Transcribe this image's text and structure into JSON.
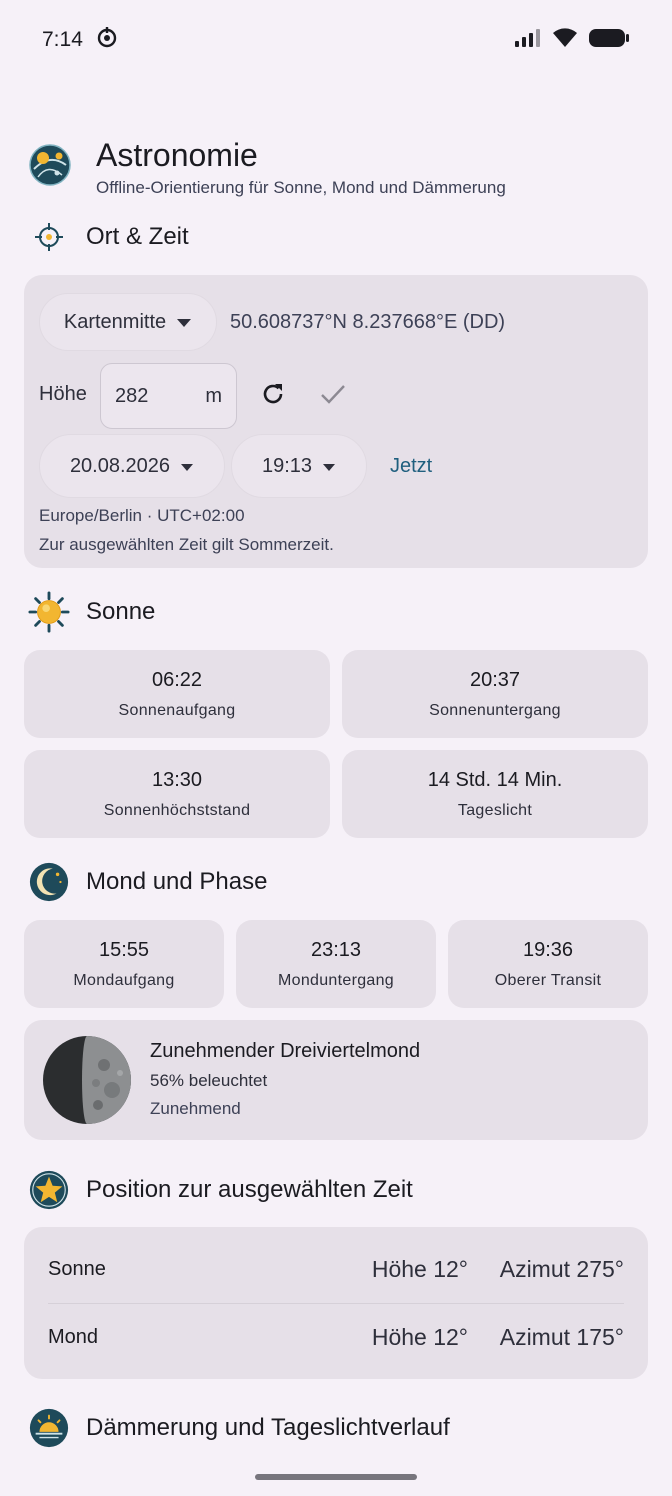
{
  "status": {
    "time": "7:14"
  },
  "header": {
    "title": "Astronomie",
    "subtitle": "Offline-Orientierung für Sonne, Mond und Dämmerung"
  },
  "location_time": {
    "section_title": "Ort & Zeit",
    "source_select": "Kartenmitte",
    "coordinates": "50.608737°N 8.237668°E (DD)",
    "height_label": "Höhe",
    "height_value": "282",
    "height_unit": "m",
    "date": "20.08.2026",
    "time": "19:13",
    "now_button": "Jetzt",
    "timezone": "Europe/Berlin · UTC+02:00",
    "dst_note": "Zur ausgewählten Zeit gilt Sommerzeit."
  },
  "sun": {
    "section_title": "Sonne",
    "tiles": [
      {
        "value": "06:22",
        "label": "Sonnenaufgang"
      },
      {
        "value": "20:37",
        "label": "Sonnenuntergang"
      },
      {
        "value": "13:30",
        "label": "Sonnenhöchststand"
      },
      {
        "value": "14 Std. 14 Min.",
        "label": "Tageslicht"
      }
    ]
  },
  "moon": {
    "section_title": "Mond und Phase",
    "tiles": [
      {
        "value": "15:55",
        "label": "Mondaufgang"
      },
      {
        "value": "23:13",
        "label": "Monduntergang"
      },
      {
        "value": "19:36",
        "label": "Oberer Transit"
      }
    ],
    "phase_name": "Zunehmender Dreiviertelmond",
    "illumination": "56% beleuchtet",
    "trend": "Zunehmend",
    "illumination_fraction": 0.56
  },
  "position": {
    "section_title": "Position zur ausgewählten Zeit",
    "rows": [
      {
        "name": "Sonne",
        "altitude": "Höhe 12°",
        "azimuth": "Azimut 275°"
      },
      {
        "name": "Mond",
        "altitude": "Höhe 12°",
        "azimuth": "Azimut 175°"
      }
    ]
  },
  "twilight": {
    "section_title": "Dämmerung und Tageslichtverlauf"
  },
  "colors": {
    "background": "#f6f1f8",
    "card": "#e6e0e8",
    "accent": "#1f5f7e",
    "icon_dark": "#1e4a5a"
  }
}
